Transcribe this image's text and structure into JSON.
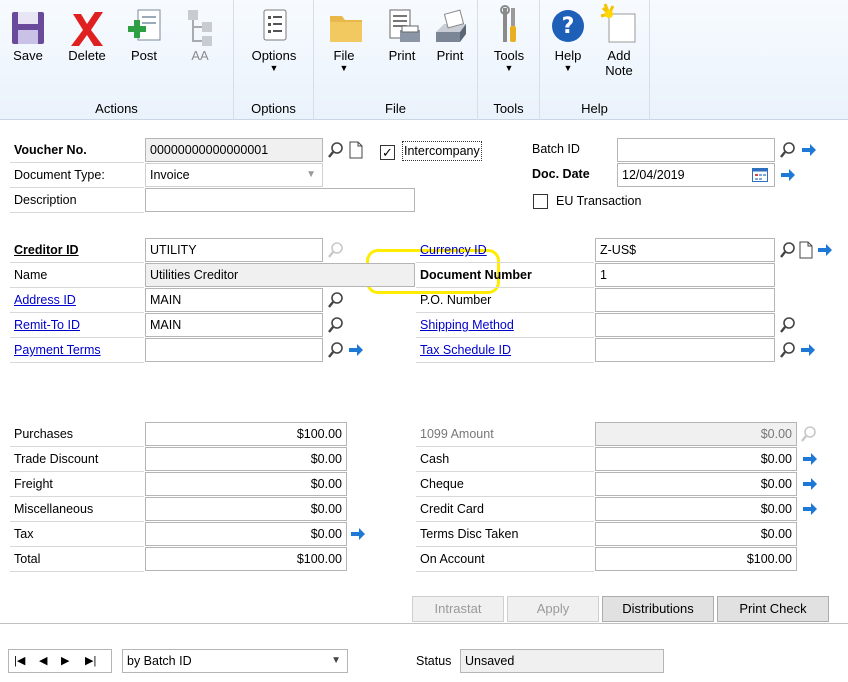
{
  "ribbon": {
    "groups": [
      {
        "label": "Actions"
      },
      {
        "label": "Options"
      },
      {
        "label": "File"
      },
      {
        "label": "Tools"
      },
      {
        "label": "Help"
      }
    ],
    "buttons": {
      "save": "Save",
      "delete": "Delete",
      "post": "Post",
      "aa": "AA",
      "options": "Options",
      "file": "File",
      "print1": "Print",
      "print2": "Print",
      "tools": "Tools",
      "help": "Help",
      "add_note": "Add\nNote"
    },
    "icons": [
      "save-icon",
      "delete-icon",
      "post-icon",
      "aa-icon",
      "options-icon",
      "file-icon",
      "print-document-icon",
      "printer-icon",
      "tools-icon",
      "help-icon",
      "add-note-icon"
    ],
    "colors": {
      "accent": "#1e78d6",
      "delete_red": "#e02020",
      "folder_yellow": "#e8b84a"
    }
  },
  "header_left": {
    "voucher_no": {
      "label": "Voucher No.",
      "value": "00000000000000001"
    },
    "document_type": {
      "label": "Document Type:",
      "value": "Invoice"
    },
    "description": {
      "label": "Description",
      "value": ""
    },
    "intercompany": {
      "label": "Intercompany",
      "checked": true,
      "check_mark": "✓"
    }
  },
  "header_right": {
    "batch_id": {
      "label": "Batch ID",
      "value": ""
    },
    "doc_date": {
      "label": "Doc. Date",
      "value": "12/04/2019"
    },
    "eu_transaction": {
      "label": "EU Transaction",
      "checked": false
    }
  },
  "creditor": {
    "creditor_id": {
      "label": "Creditor ID",
      "value": "UTILITY"
    },
    "name": {
      "label": "Name",
      "value": "Utilities Creditor"
    },
    "address_id": {
      "label": "Address ID",
      "value": "MAIN"
    },
    "remit_to_id": {
      "label": "Remit-To ID",
      "value": "MAIN"
    },
    "payment_terms": {
      "label": "Payment Terms",
      "value": ""
    }
  },
  "currency": {
    "currency_id": {
      "label": "Currency ID",
      "value": "Z-US$"
    },
    "document_number": {
      "label": "Document Number",
      "value": "1"
    },
    "po_number": {
      "label": "P.O. Number",
      "value": ""
    },
    "shipping_method": {
      "label": "Shipping Method",
      "value": ""
    },
    "tax_schedule_id": {
      "label": "Tax Schedule ID",
      "value": ""
    }
  },
  "amounts_left": [
    {
      "label": "Purchases",
      "value": "$100.00"
    },
    {
      "label": "Trade Discount",
      "value": "$0.00"
    },
    {
      "label": "Freight",
      "value": "$0.00"
    },
    {
      "label": "Miscellaneous",
      "value": "$0.00"
    },
    {
      "label": "Tax",
      "value": "$0.00"
    },
    {
      "label": "Total",
      "value": "$100.00"
    }
  ],
  "amounts_right": [
    {
      "label": "1099 Amount",
      "value": "$0.00"
    },
    {
      "label": "Cash",
      "value": "$0.00"
    },
    {
      "label": "Cheque",
      "value": "$0.00"
    },
    {
      "label": "Credit Card",
      "value": "$0.00"
    },
    {
      "label": "Terms Disc Taken",
      "value": "$0.00"
    },
    {
      "label": "On Account",
      "value": "$100.00"
    }
  ],
  "buttons": {
    "intrastat": "Intrastat",
    "apply": "Apply",
    "distributions": "Distributions",
    "print_check": "Print Check"
  },
  "footer": {
    "nav": {
      "first": "|◀",
      "prev": "◀",
      "next": "▶",
      "last": "▶|"
    },
    "sort_by": "by Batch ID",
    "status_label": "Status",
    "status_value": "Unsaved"
  }
}
